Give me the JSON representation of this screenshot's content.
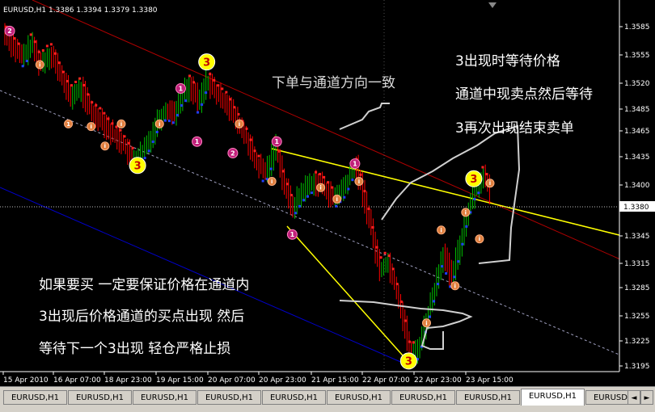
{
  "header": {
    "symbol_info": "EURUSD,H1  1.3386 1.3394 1.3379 1.3380"
  },
  "chart_data": {
    "type": "line",
    "symbol": "EURUSD",
    "timeframe": "H1",
    "ohlc": {
      "open": 1.3386,
      "high": 1.3394,
      "low": 1.3379,
      "close": 1.338
    },
    "x_ticks": [
      "15 Apr 2010",
      "16 Apr 07:00",
      "18 Apr 23:00",
      "19 Apr 15:00",
      "20 Apr 07:00",
      "20 Apr 23:00",
      "21 Apr 15:00",
      "22 Apr 07:00",
      "22 Apr 23:00",
      "23 Apr 15:00"
    ],
    "y_ticks": [
      "1.3585",
      "1.3555",
      "1.3520",
      "1.3485",
      "1.3465",
      "1.3435",
      "1.3400",
      "1.3345",
      "1.3315",
      "1.3285",
      "1.3255",
      "1.3225",
      "1.3195"
    ],
    "current_price": "1.3380",
    "ylim": [
      1.3185,
      1.3605
    ],
    "price_series": [
      {
        "x": 0,
        "y": 1.3568
      },
      {
        "x": 12,
        "y": 1.3552
      },
      {
        "x": 22,
        "y": 1.354
      },
      {
        "x": 35,
        "y": 1.3555
      },
      {
        "x": 45,
        "y": 1.3532
      },
      {
        "x": 58,
        "y": 1.3545
      },
      {
        "x": 70,
        "y": 1.352
      },
      {
        "x": 82,
        "y": 1.3495
      },
      {
        "x": 95,
        "y": 1.3505
      },
      {
        "x": 108,
        "y": 1.3478
      },
      {
        "x": 120,
        "y": 1.347
      },
      {
        "x": 132,
        "y": 1.3455
      },
      {
        "x": 145,
        "y": 1.3445
      },
      {
        "x": 158,
        "y": 1.3425
      },
      {
        "x": 170,
        "y": 1.3432
      },
      {
        "x": 180,
        "y": 1.3448
      },
      {
        "x": 190,
        "y": 1.347
      },
      {
        "x": 200,
        "y": 1.3482
      },
      {
        "x": 210,
        "y": 1.3478
      },
      {
        "x": 220,
        "y": 1.35
      },
      {
        "x": 230,
        "y": 1.3508
      },
      {
        "x": 240,
        "y": 1.3488
      },
      {
        "x": 250,
        "y": 1.3515
      },
      {
        "x": 262,
        "y": 1.3498
      },
      {
        "x": 275,
        "y": 1.3488
      },
      {
        "x": 285,
        "y": 1.347
      },
      {
        "x": 298,
        "y": 1.345
      },
      {
        "x": 310,
        "y": 1.342
      },
      {
        "x": 322,
        "y": 1.341
      },
      {
        "x": 335,
        "y": 1.344
      },
      {
        "x": 345,
        "y": 1.3395
      },
      {
        "x": 355,
        "y": 1.337
      },
      {
        "x": 368,
        "y": 1.339
      },
      {
        "x": 380,
        "y": 1.34
      },
      {
        "x": 392,
        "y": 1.3395
      },
      {
        "x": 405,
        "y": 1.338
      },
      {
        "x": 420,
        "y": 1.3395
      },
      {
        "x": 432,
        "y": 1.342
      },
      {
        "x": 442,
        "y": 1.3385
      },
      {
        "x": 452,
        "y": 1.3345
      },
      {
        "x": 462,
        "y": 1.33
      },
      {
        "x": 472,
        "y": 1.331
      },
      {
        "x": 482,
        "y": 1.328
      },
      {
        "x": 492,
        "y": 1.324
      },
      {
        "x": 500,
        "y": 1.3202
      },
      {
        "x": 510,
        "y": 1.3212
      },
      {
        "x": 520,
        "y": 1.3245
      },
      {
        "x": 530,
        "y": 1.328
      },
      {
        "x": 540,
        "y": 1.332
      },
      {
        "x": 550,
        "y": 1.329
      },
      {
        "x": 560,
        "y": 1.3325
      },
      {
        "x": 570,
        "y": 1.3365
      },
      {
        "x": 580,
        "y": 1.3395
      },
      {
        "x": 590,
        "y": 1.3405
      },
      {
        "x": 600,
        "y": 1.3383
      }
    ],
    "markers": [
      {
        "label": "2",
        "x": 8,
        "y": 1.357,
        "kind": "magenta"
      },
      {
        "label": "i",
        "x": 45,
        "y": 1.3532,
        "kind": "orange"
      },
      {
        "label": "1",
        "x": 80,
        "y": 1.3465,
        "kind": "orange"
      },
      {
        "label": "i",
        "x": 108,
        "y": 1.3462,
        "kind": "orange"
      },
      {
        "label": "i",
        "x": 125,
        "y": 1.344,
        "kind": "orange"
      },
      {
        "label": "i",
        "x": 145,
        "y": 1.3465,
        "kind": "orange"
      },
      {
        "label": "3",
        "x": 165,
        "y": 1.3418,
        "kind": "yellow"
      },
      {
        "label": "i",
        "x": 192,
        "y": 1.3465,
        "kind": "orange"
      },
      {
        "label": "1",
        "x": 218,
        "y": 1.3505,
        "kind": "magenta"
      },
      {
        "label": "3",
        "x": 250,
        "y": 1.3535,
        "kind": "yellow"
      },
      {
        "label": "1",
        "x": 238,
        "y": 1.3445,
        "kind": "magenta"
      },
      {
        "label": "2",
        "x": 282,
        "y": 1.3432,
        "kind": "magenta"
      },
      {
        "label": "i",
        "x": 290,
        "y": 1.3465,
        "kind": "orange"
      },
      {
        "label": "1",
        "x": 336,
        "y": 1.3445,
        "kind": "magenta"
      },
      {
        "label": "i",
        "x": 330,
        "y": 1.34,
        "kind": "orange"
      },
      {
        "label": "1",
        "x": 355,
        "y": 1.334,
        "kind": "magenta"
      },
      {
        "label": "i",
        "x": 390,
        "y": 1.3393,
        "kind": "orange"
      },
      {
        "label": "i",
        "x": 410,
        "y": 1.338,
        "kind": "orange"
      },
      {
        "label": "1",
        "x": 432,
        "y": 1.342,
        "kind": "magenta"
      },
      {
        "label": "i",
        "x": 437,
        "y": 1.34,
        "kind": "orange"
      },
      {
        "label": "i",
        "x": 538,
        "y": 1.3345,
        "kind": "orange"
      },
      {
        "label": "i",
        "x": 555,
        "y": 1.3282,
        "kind": "orange"
      },
      {
        "label": "i",
        "x": 568,
        "y": 1.3365,
        "kind": "orange"
      },
      {
        "label": "i",
        "x": 585,
        "y": 1.3335,
        "kind": "orange"
      },
      {
        "label": "3",
        "x": 578,
        "y": 1.3403,
        "kind": "yellow"
      },
      {
        "label": "i",
        "x": 598,
        "y": 1.3398,
        "kind": "orange"
      },
      {
        "label": "3",
        "x": 498,
        "y": 1.3197,
        "kind": "yellow"
      },
      {
        "label": "i",
        "x": 520,
        "y": 1.324,
        "kind": "orange"
      }
    ],
    "annotations": [
      {
        "text": "下单与通道方向一致"
      },
      {
        "text": "3出现时等待价格"
      },
      {
        "text": "通道中现卖点然后等待"
      },
      {
        "text": "3再次出现结束卖单"
      },
      {
        "text": "如果要买  一定要保证价格在通道内"
      },
      {
        "text": "3出现后价格通道的买点出现  然后"
      },
      {
        "text": "等待下一个3出现  轻仓严格止损"
      }
    ],
    "colors": {
      "background": "#000000",
      "up": "#00c000",
      "down": "#ff0000",
      "trendline": "#ffff00",
      "channel_upper": "#c00000",
      "channel_lower": "#0000cc",
      "guide": "#c0c0c0"
    }
  },
  "tabs": [
    {
      "label": "EURUSD,H1",
      "active": false
    },
    {
      "label": "EURUSD,H1",
      "active": false
    },
    {
      "label": "EURUSD,H1",
      "active": false
    },
    {
      "label": "EURUSD,H1",
      "active": false
    },
    {
      "label": "EURUSD,H1",
      "active": false
    },
    {
      "label": "EURUSD,H1",
      "active": false
    },
    {
      "label": "EURUSD,H1",
      "active": false
    },
    {
      "label": "EURUSD,H1",
      "active": false
    },
    {
      "label": "EURUSD,H1",
      "active": true
    },
    {
      "label": "EURUSD,H1",
      "active": false
    }
  ]
}
